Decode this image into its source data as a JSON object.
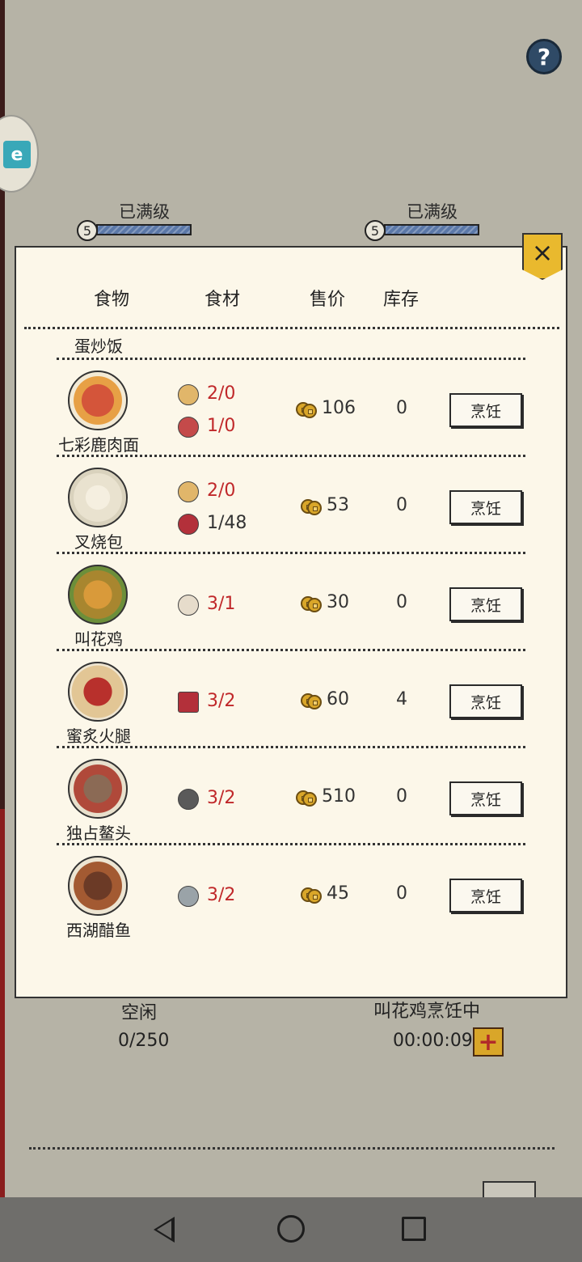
{
  "levels": [
    {
      "label": "已满级",
      "level": "5"
    },
    {
      "label": "已满级",
      "level": "5"
    }
  ],
  "icons": {
    "help": "?",
    "close": "×",
    "plus": "+",
    "back": "‹"
  },
  "table": {
    "headers": {
      "food": "食物",
      "ingredients": "食材",
      "price": "售价",
      "stock": "库存"
    },
    "partial_row": "蛋炒饭",
    "rows": [
      {
        "name": "七彩鹿肉面",
        "ingredients": [
          {
            "icon": "noodle-icon",
            "count": "2/0",
            "color": "red"
          },
          {
            "icon": "venison-icon",
            "count": "1/0",
            "color": "red"
          }
        ],
        "price": "106",
        "stock": "0",
        "button": "烹饪"
      },
      {
        "name": "叉烧包",
        "ingredients": [
          {
            "icon": "flour-icon",
            "count": "2/0",
            "color": "red"
          },
          {
            "icon": "pork-icon",
            "count": "1/48",
            "color": "dark"
          }
        ],
        "price": "53",
        "stock": "0",
        "button": "烹饪"
      },
      {
        "name": "叫花鸡",
        "ingredients": [
          {
            "icon": "chicken-icon",
            "count": "3/1",
            "color": "red"
          }
        ],
        "price": "30",
        "stock": "0",
        "button": "烹饪"
      },
      {
        "name": "蜜炙火腿",
        "ingredients": [
          {
            "icon": "ham-icon",
            "count": "3/2",
            "color": "red"
          }
        ],
        "price": "60",
        "stock": "4",
        "button": "烹饪"
      },
      {
        "name": "独占鳌头",
        "ingredients": [
          {
            "icon": "turtle-icon",
            "count": "3/2",
            "color": "red"
          }
        ],
        "price": "510",
        "stock": "0",
        "button": "烹饪"
      },
      {
        "name": "西湖醋鱼",
        "ingredients": [
          {
            "icon": "fish-icon",
            "count": "3/2",
            "color": "red"
          }
        ],
        "price": "45",
        "stock": "0",
        "button": "烹饪"
      }
    ]
  },
  "status": {
    "left_state": "空闲",
    "capacity": "0/250",
    "right_state": "叫花鸡烹饪中",
    "timer": "00:00:09"
  },
  "colors": {
    "background": "#b6b3a6",
    "panel": "#fcf7e9",
    "accent_red": "#c0282a",
    "coin_gold": "#d9a629",
    "close_yellow": "#e9b92e",
    "level_bar": "#5b78a8"
  }
}
